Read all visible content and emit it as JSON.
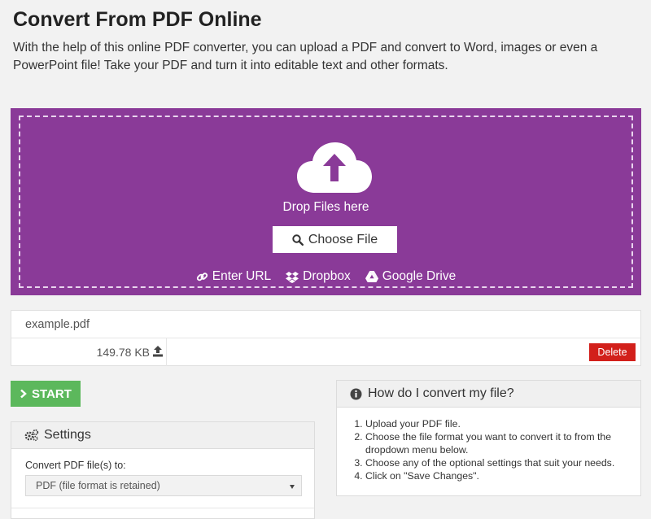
{
  "header": {
    "title": "Convert From PDF Online",
    "intro": "With the help of this online PDF converter, you can upload a PDF and convert to Word, images or even a PowerPoint file! Take your PDF and turn it into editable text and other formats."
  },
  "upload": {
    "drop_text": "Drop Files here",
    "choose_label": "Choose File",
    "sources": {
      "url": "Enter URL",
      "dropbox": "Dropbox",
      "gdrive": "Google Drive"
    },
    "background_color": "#8a3a98"
  },
  "file": {
    "name": "example.pdf",
    "size": "149.78 KB",
    "delete_label": "Delete"
  },
  "start": {
    "label": "START",
    "color": "#5cb85c"
  },
  "settings": {
    "title": "Settings",
    "convert_label": "Convert PDF file(s) to:",
    "selected_format": "PDF (file format is retained)"
  },
  "howto": {
    "title": "How do I convert my file?",
    "steps": [
      "Upload your PDF file.",
      "Choose the file format you want to convert it to from the dropdown menu below.",
      "Choose any of the optional settings that suit your needs.",
      "Click on \"Save Changes\"."
    ]
  },
  "icons": [
    "cloud-upload-icon",
    "search-icon",
    "link-icon",
    "dropbox-icon",
    "google-drive-icon",
    "upload-icon",
    "chevron-right-icon",
    "gears-icon",
    "info-circle-icon"
  ]
}
